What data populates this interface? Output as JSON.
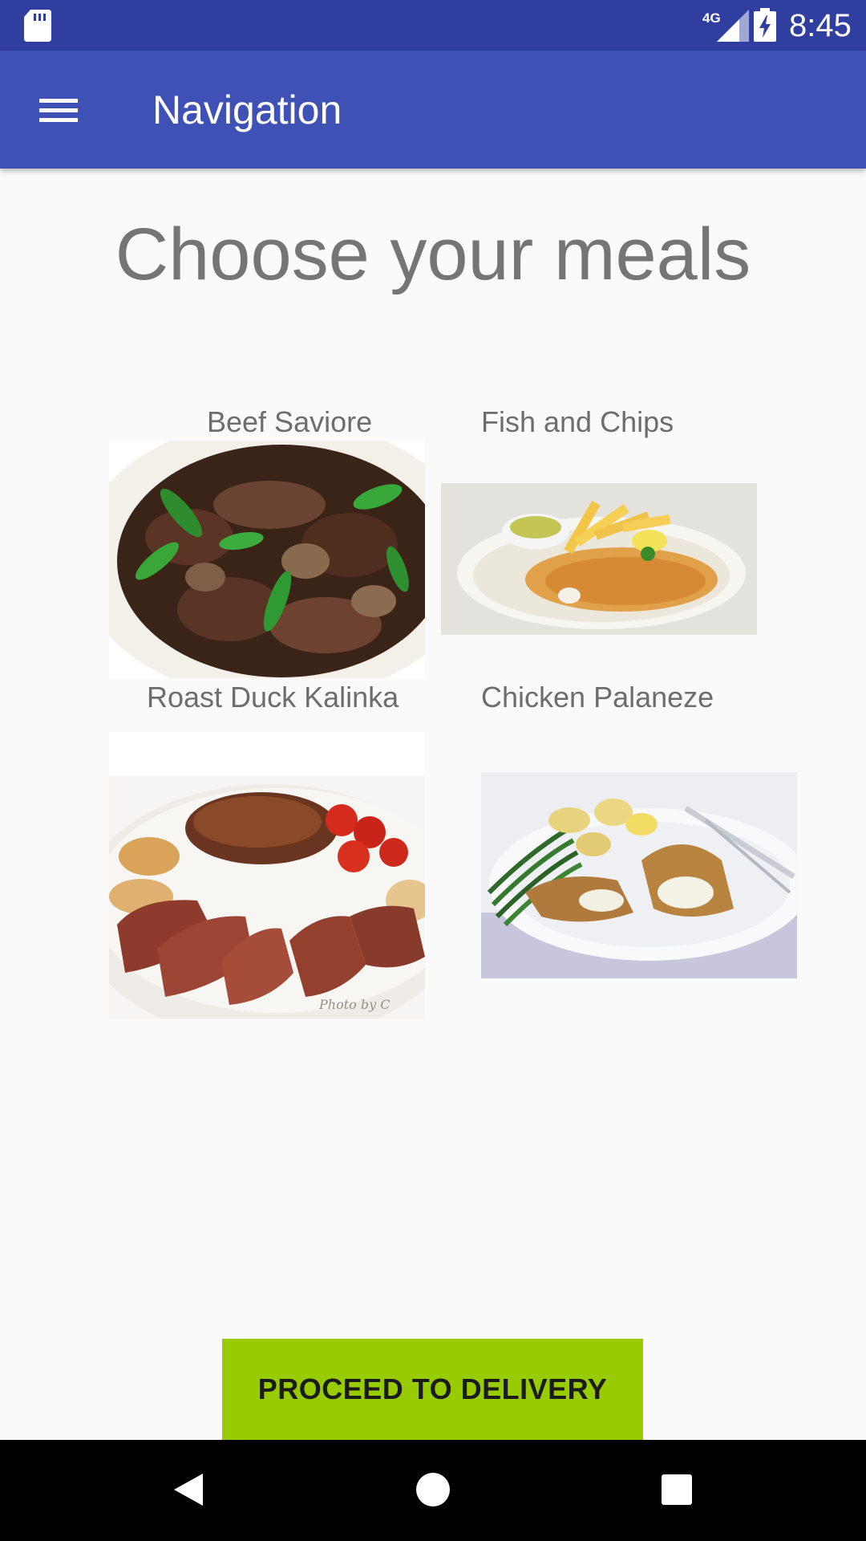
{
  "status_bar": {
    "time": "8:45",
    "network": "4G",
    "icons": [
      "sd-card-icon",
      "signal-icon",
      "battery-charging-icon"
    ]
  },
  "toolbar": {
    "title": "Navigation",
    "menu_icon": "menu-icon",
    "color": "#3f51b5",
    "status_color": "#303f9f"
  },
  "main": {
    "heading": "Choose your meals",
    "meals": [
      {
        "name": "Beef Saviore"
      },
      {
        "name": "Fish and Chips"
      },
      {
        "name": "Roast Duck Kalinka",
        "watermark": "Photo by C"
      },
      {
        "name": "Chicken Palaneze"
      }
    ]
  },
  "footer": {
    "proceed_label": "PROCEED TO DELIVERY",
    "button_color": "#99cc00"
  },
  "nav_bar": {
    "icons": [
      "back-icon",
      "home-icon",
      "recents-icon"
    ]
  }
}
